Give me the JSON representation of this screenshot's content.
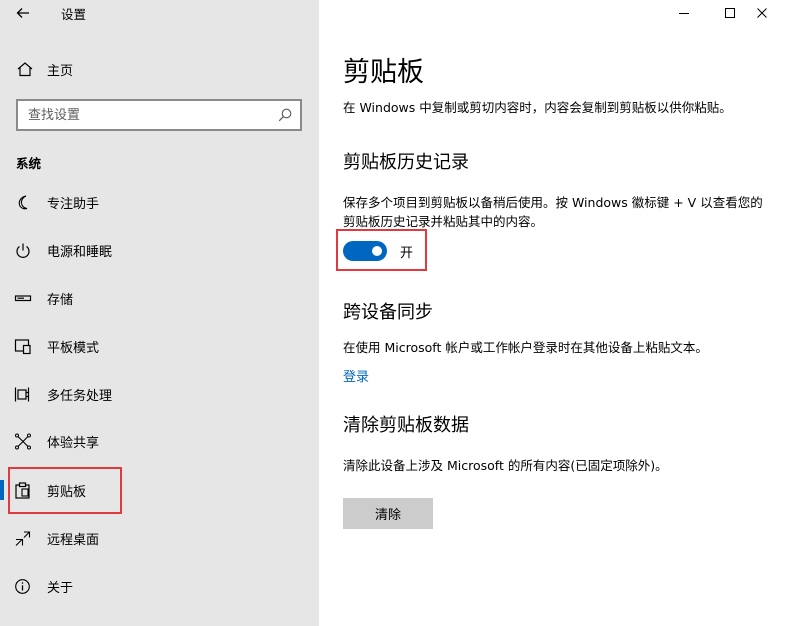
{
  "window": {
    "title": "设置",
    "controls": {
      "minimize_icon": "minimize-icon",
      "maximize_icon": "maximize-icon",
      "close_icon": "close-icon"
    }
  },
  "sidebar": {
    "home_label": "主页",
    "search_placeholder": "查找设置",
    "section_label": "系统",
    "items": [
      {
        "label": "专注助手",
        "icon": "moon-icon"
      },
      {
        "label": "电源和睡眠",
        "icon": "power-icon"
      },
      {
        "label": "存储",
        "icon": "storage-icon"
      },
      {
        "label": "平板模式",
        "icon": "tablet-mode-icon"
      },
      {
        "label": "多任务处理",
        "icon": "multitasking-icon"
      },
      {
        "label": "体验共享",
        "icon": "share-icon"
      },
      {
        "label": "剪贴板",
        "icon": "clipboard-icon",
        "active": true
      },
      {
        "label": "远程桌面",
        "icon": "remote-desktop-icon"
      },
      {
        "label": "关于",
        "icon": "info-icon"
      }
    ]
  },
  "content": {
    "title": "剪贴板",
    "intro": "在 Windows 中复制或剪切内容时，内容会复制到剪贴板以供你粘贴。",
    "history": {
      "heading": "剪贴板历史记录",
      "description": "保存多个项目到剪贴板以备稍后使用。按 Windows 徽标键 + V 以查看您的剪贴板历史记录并粘贴其中的内容。",
      "toggle_label": "开",
      "toggle_on": true
    },
    "sync": {
      "heading": "跨设备同步",
      "description": "在使用 Microsoft 帐户或工作帐户登录时在其他设备上粘贴文本。",
      "link_label": "登录"
    },
    "clear": {
      "heading": "清除剪贴板数据",
      "description": "清除此设备上涉及 Microsoft 的所有内容(已固定项除外)。",
      "button_label": "清除"
    }
  },
  "colors": {
    "accent": "#0067c0",
    "highlight": "#e0393e",
    "sidebar_bg": "#e6e6e6"
  }
}
